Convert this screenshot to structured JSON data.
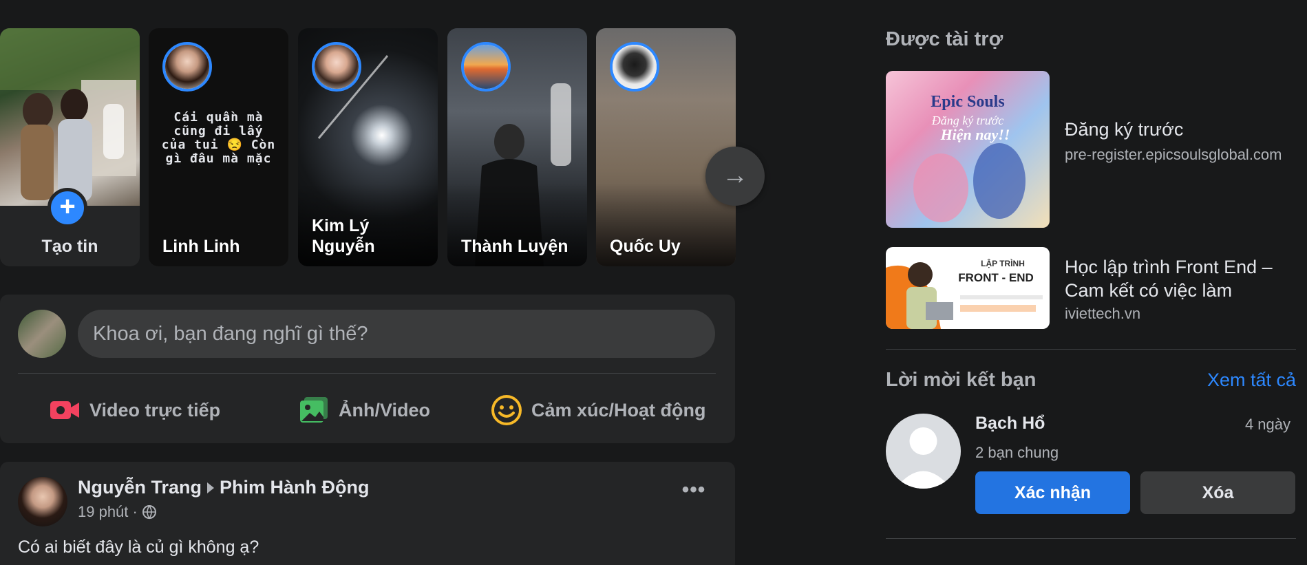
{
  "stories": {
    "create": {
      "label": "Tạo tin"
    },
    "items": [
      {
        "name": "Linh Linh",
        "caption": "Cái quần mà cũng đi lấy của tui 😒 Còn gì đâu mà mặc"
      },
      {
        "name": "Kim Lý Nguyễn",
        "caption": ""
      },
      {
        "name": "Thành Luyện",
        "caption": ""
      },
      {
        "name": "Quốc Uy",
        "caption": ""
      }
    ],
    "next_icon": "→"
  },
  "composer": {
    "placeholder": "Khoa ơi, bạn đang nghĩ gì thế?",
    "actions": [
      {
        "label": "Video trực tiếp",
        "icon": "live-video-icon",
        "color": "#f3425f"
      },
      {
        "label": "Ảnh/Video",
        "icon": "photo-icon",
        "color": "#45bd62"
      },
      {
        "label": "Cảm xúc/Hoạt động",
        "icon": "feeling-icon",
        "color": "#f7b928"
      }
    ]
  },
  "post": {
    "author": "Nguyễn Trang",
    "group": "Phim Hành Động",
    "time": "19 phút · ",
    "text": "Có ai biết đây là củ gì không ạ?"
  },
  "sponsored": {
    "title": "Được tài trợ",
    "ads": [
      {
        "title": "Đăng ký trước",
        "domain": "pre-register.epicsoulsglobal.com",
        "thumb_text": "Epic Souls — Đăng ký trước Hiện nay!!"
      },
      {
        "title": "Học lập trình Front End – Cam kết có việc làm",
        "domain": "iviettech.vn",
        "thumb_text": "LẬP TRÌNH FRONT - END"
      }
    ]
  },
  "friend_requests": {
    "title": "Lời mời kết bạn",
    "see_all": "Xem tất cả",
    "request": {
      "name": "Bạch Hổ",
      "time": "4 ngày",
      "mutual": "2 bạn chung",
      "confirm": "Xác nhận",
      "delete": "Xóa"
    }
  },
  "colors": {
    "background": "#18191a",
    "card": "#242526",
    "accent": "#2d88ff",
    "text": "#e4e6eb",
    "secondary_text": "#b0b3b8"
  }
}
